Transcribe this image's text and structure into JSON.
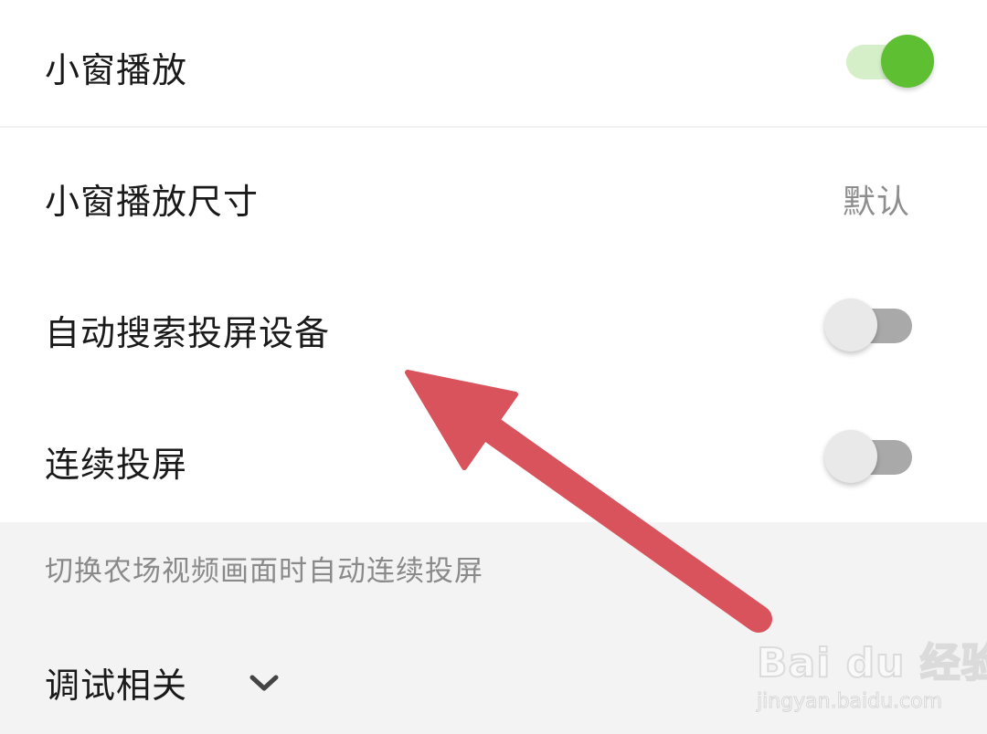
{
  "settings": {
    "items": [
      {
        "label": "小窗播放",
        "type": "toggle",
        "state": "on"
      },
      {
        "label": "小窗播放尺寸",
        "type": "value",
        "value": "默认"
      },
      {
        "label": "自动搜索投屏设备",
        "type": "toggle",
        "state": "off"
      },
      {
        "label": "连续投屏",
        "type": "toggle",
        "state": "off"
      }
    ],
    "hint": "切换农场视频画面时自动连续投屏",
    "debug_section": {
      "label": "调试相关",
      "icon": "chevron-down-icon"
    }
  },
  "annotation": {
    "icon": "red-arrow-icon",
    "color": "#d9535c"
  },
  "watermark": {
    "logo": "Bai du 经验",
    "url": "jingyan.baidu.com"
  },
  "colors": {
    "toggle_on": "#5dbf31",
    "toggle_on_track": "#d5f0c9",
    "toggle_off_track": "#a9a9a9"
  }
}
